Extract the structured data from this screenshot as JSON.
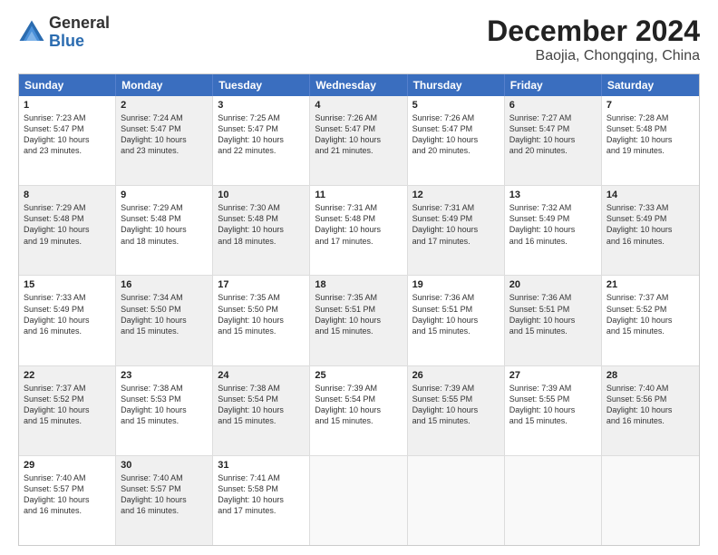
{
  "logo": {
    "general": "General",
    "blue": "Blue"
  },
  "title": "December 2024",
  "subtitle": "Baojia, Chongqing, China",
  "header_days": [
    "Sunday",
    "Monday",
    "Tuesday",
    "Wednesday",
    "Thursday",
    "Friday",
    "Saturday"
  ],
  "weeks": [
    [
      {
        "day": "1",
        "info": "Sunrise: 7:23 AM\nSunset: 5:47 PM\nDaylight: 10 hours\nand 23 minutes.",
        "shaded": false
      },
      {
        "day": "2",
        "info": "Sunrise: 7:24 AM\nSunset: 5:47 PM\nDaylight: 10 hours\nand 23 minutes.",
        "shaded": true
      },
      {
        "day": "3",
        "info": "Sunrise: 7:25 AM\nSunset: 5:47 PM\nDaylight: 10 hours\nand 22 minutes.",
        "shaded": false
      },
      {
        "day": "4",
        "info": "Sunrise: 7:26 AM\nSunset: 5:47 PM\nDaylight: 10 hours\nand 21 minutes.",
        "shaded": true
      },
      {
        "day": "5",
        "info": "Sunrise: 7:26 AM\nSunset: 5:47 PM\nDaylight: 10 hours\nand 20 minutes.",
        "shaded": false
      },
      {
        "day": "6",
        "info": "Sunrise: 7:27 AM\nSunset: 5:47 PM\nDaylight: 10 hours\nand 20 minutes.",
        "shaded": true
      },
      {
        "day": "7",
        "info": "Sunrise: 7:28 AM\nSunset: 5:48 PM\nDaylight: 10 hours\nand 19 minutes.",
        "shaded": false
      }
    ],
    [
      {
        "day": "8",
        "info": "Sunrise: 7:29 AM\nSunset: 5:48 PM\nDaylight: 10 hours\nand 19 minutes.",
        "shaded": true
      },
      {
        "day": "9",
        "info": "Sunrise: 7:29 AM\nSunset: 5:48 PM\nDaylight: 10 hours\nand 18 minutes.",
        "shaded": false
      },
      {
        "day": "10",
        "info": "Sunrise: 7:30 AM\nSunset: 5:48 PM\nDaylight: 10 hours\nand 18 minutes.",
        "shaded": true
      },
      {
        "day": "11",
        "info": "Sunrise: 7:31 AM\nSunset: 5:48 PM\nDaylight: 10 hours\nand 17 minutes.",
        "shaded": false
      },
      {
        "day": "12",
        "info": "Sunrise: 7:31 AM\nSunset: 5:49 PM\nDaylight: 10 hours\nand 17 minutes.",
        "shaded": true
      },
      {
        "day": "13",
        "info": "Sunrise: 7:32 AM\nSunset: 5:49 PM\nDaylight: 10 hours\nand 16 minutes.",
        "shaded": false
      },
      {
        "day": "14",
        "info": "Sunrise: 7:33 AM\nSunset: 5:49 PM\nDaylight: 10 hours\nand 16 minutes.",
        "shaded": true
      }
    ],
    [
      {
        "day": "15",
        "info": "Sunrise: 7:33 AM\nSunset: 5:49 PM\nDaylight: 10 hours\nand 16 minutes.",
        "shaded": false
      },
      {
        "day": "16",
        "info": "Sunrise: 7:34 AM\nSunset: 5:50 PM\nDaylight: 10 hours\nand 15 minutes.",
        "shaded": true
      },
      {
        "day": "17",
        "info": "Sunrise: 7:35 AM\nSunset: 5:50 PM\nDaylight: 10 hours\nand 15 minutes.",
        "shaded": false
      },
      {
        "day": "18",
        "info": "Sunrise: 7:35 AM\nSunset: 5:51 PM\nDaylight: 10 hours\nand 15 minutes.",
        "shaded": true
      },
      {
        "day": "19",
        "info": "Sunrise: 7:36 AM\nSunset: 5:51 PM\nDaylight: 10 hours\nand 15 minutes.",
        "shaded": false
      },
      {
        "day": "20",
        "info": "Sunrise: 7:36 AM\nSunset: 5:51 PM\nDaylight: 10 hours\nand 15 minutes.",
        "shaded": true
      },
      {
        "day": "21",
        "info": "Sunrise: 7:37 AM\nSunset: 5:52 PM\nDaylight: 10 hours\nand 15 minutes.",
        "shaded": false
      }
    ],
    [
      {
        "day": "22",
        "info": "Sunrise: 7:37 AM\nSunset: 5:52 PM\nDaylight: 10 hours\nand 15 minutes.",
        "shaded": true
      },
      {
        "day": "23",
        "info": "Sunrise: 7:38 AM\nSunset: 5:53 PM\nDaylight: 10 hours\nand 15 minutes.",
        "shaded": false
      },
      {
        "day": "24",
        "info": "Sunrise: 7:38 AM\nSunset: 5:54 PM\nDaylight: 10 hours\nand 15 minutes.",
        "shaded": true
      },
      {
        "day": "25",
        "info": "Sunrise: 7:39 AM\nSunset: 5:54 PM\nDaylight: 10 hours\nand 15 minutes.",
        "shaded": false
      },
      {
        "day": "26",
        "info": "Sunrise: 7:39 AM\nSunset: 5:55 PM\nDaylight: 10 hours\nand 15 minutes.",
        "shaded": true
      },
      {
        "day": "27",
        "info": "Sunrise: 7:39 AM\nSunset: 5:55 PM\nDaylight: 10 hours\nand 15 minutes.",
        "shaded": false
      },
      {
        "day": "28",
        "info": "Sunrise: 7:40 AM\nSunset: 5:56 PM\nDaylight: 10 hours\nand 16 minutes.",
        "shaded": true
      }
    ],
    [
      {
        "day": "29",
        "info": "Sunrise: 7:40 AM\nSunset: 5:57 PM\nDaylight: 10 hours\nand 16 minutes.",
        "shaded": false
      },
      {
        "day": "30",
        "info": "Sunrise: 7:40 AM\nSunset: 5:57 PM\nDaylight: 10 hours\nand 16 minutes.",
        "shaded": true
      },
      {
        "day": "31",
        "info": "Sunrise: 7:41 AM\nSunset: 5:58 PM\nDaylight: 10 hours\nand 17 minutes.",
        "shaded": false
      },
      {
        "day": "",
        "info": "",
        "shaded": true,
        "empty": true
      },
      {
        "day": "",
        "info": "",
        "shaded": false,
        "empty": true
      },
      {
        "day": "",
        "info": "",
        "shaded": true,
        "empty": true
      },
      {
        "day": "",
        "info": "",
        "shaded": false,
        "empty": true
      }
    ]
  ]
}
